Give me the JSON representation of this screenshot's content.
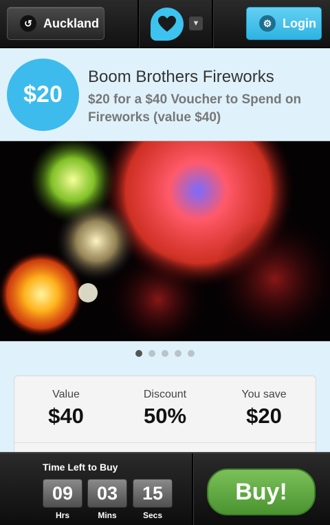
{
  "header": {
    "city_label": "Auckland",
    "login_label": "Login"
  },
  "deal": {
    "price_badge": "$20",
    "title": "Boom Brothers Fireworks",
    "subtitle": "$20 for a $40 Voucher to Spend on Fireworks (value $40)"
  },
  "gallery": {
    "slide_count": 5,
    "active_index": 0
  },
  "stats": [
    {
      "label": "Value",
      "value": "$40"
    },
    {
      "label": "Discount",
      "value": "50%"
    },
    {
      "label": "You save",
      "value": "$20"
    }
  ],
  "countdown": {
    "label": "Time Left to Buy",
    "units": [
      {
        "value": "09",
        "unit": "Hrs"
      },
      {
        "value": "03",
        "unit": "Mins"
      },
      {
        "value": "15",
        "unit": "Secs"
      }
    ]
  },
  "buy_label": "Buy!",
  "colors": {
    "accent": "#3dbbec",
    "buy_green": "#5aa83c"
  },
  "icons": {
    "back": "back-arrow-icon",
    "favorite": "heart-icon",
    "settings": "gear-icon",
    "dropdown": "triangle-down-icon"
  }
}
